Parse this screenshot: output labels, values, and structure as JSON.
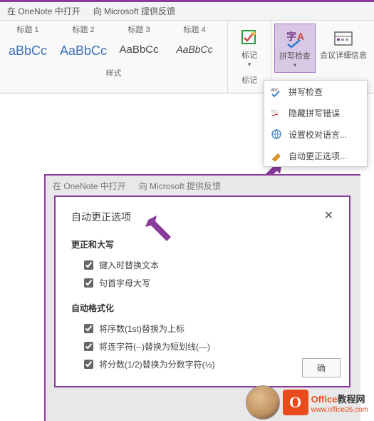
{
  "topbar": {
    "open_onenote": "在 OneNote 中打开",
    "feedback": "向 Microsoft 提供反馈"
  },
  "styles": {
    "items": [
      {
        "label": "标题 1",
        "preview": "aBbCc"
      },
      {
        "label": "标题 2",
        "preview": "AaBbCc"
      },
      {
        "label": "标题 3",
        "preview": "AaBbCc"
      },
      {
        "label": "标题 4",
        "preview": "AaBbCc"
      }
    ],
    "group": "样式"
  },
  "commands": {
    "tag": {
      "label": "标记",
      "group": "标记"
    },
    "spelling": {
      "label": "拼写检查"
    },
    "meeting": {
      "label": "会议详细信息"
    }
  },
  "menu": {
    "check": "拼写检查",
    "hide": "隐藏拼写错误",
    "lang": "设置校对语言...",
    "auto": "自动更正选项..."
  },
  "dialog": {
    "title": "自动更正选项",
    "sec1": "更正和大写",
    "opt1": "键入时替换文本",
    "opt2": "句首字母大写",
    "sec2": "自动格式化",
    "opt3": "将序数(1st)替换为上标",
    "opt4": "将连字符(--)替换为短划线(—)",
    "opt5": "将分数(1/2)替换为分数字符(½)",
    "ok": "确"
  },
  "watermark": {
    "brand": "Office",
    "suffix": "教程网",
    "url": "www.office26.com"
  }
}
